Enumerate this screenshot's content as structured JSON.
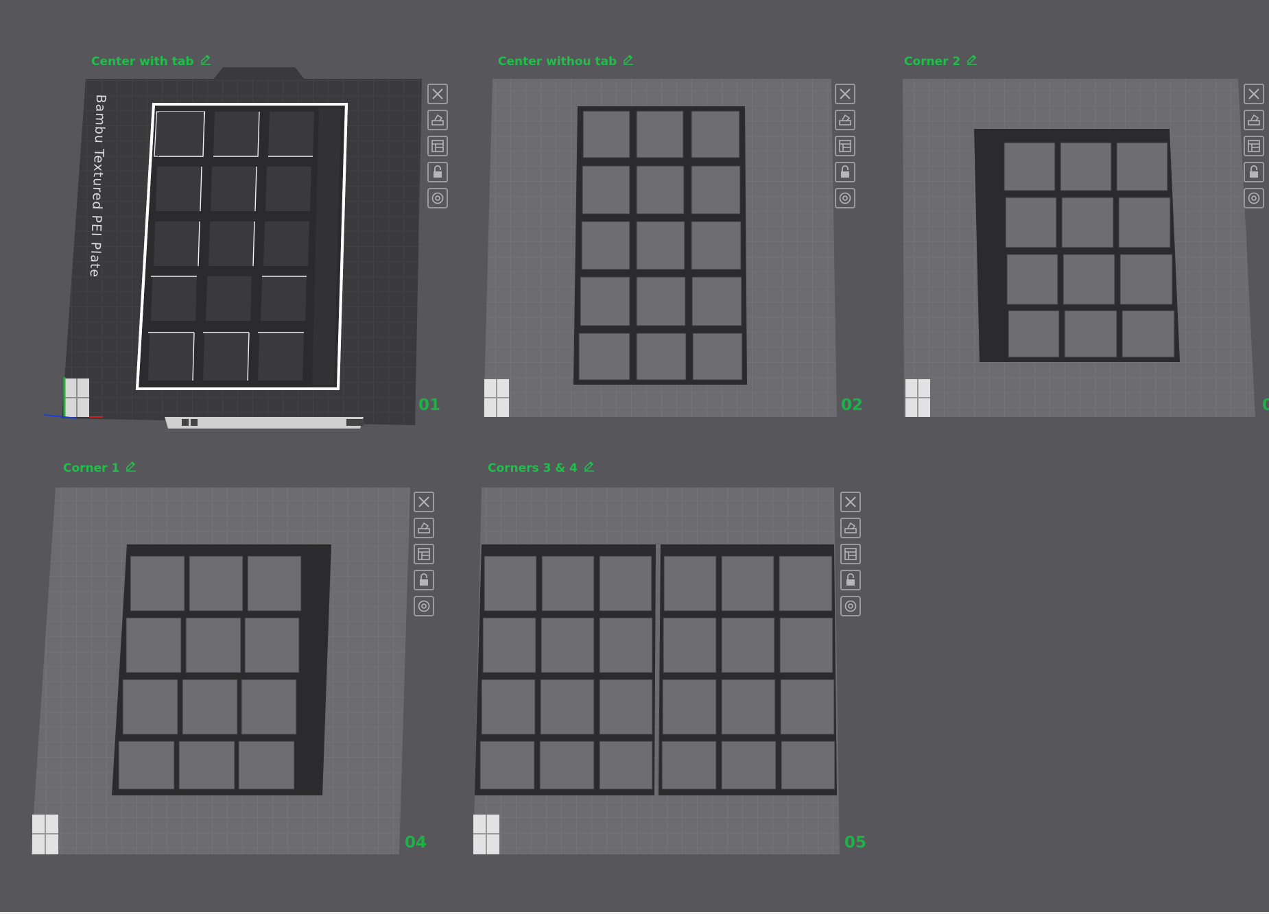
{
  "plates": [
    {
      "number": "01",
      "title": "Center with tab",
      "bed_label": "Bambu Textured PEI Plate",
      "active": true
    },
    {
      "number": "02",
      "title": "Center withou tab",
      "active": false
    },
    {
      "number": "0",
      "title": "Corner 2",
      "active": false
    },
    {
      "number": "04",
      "title": "Corner 1",
      "active": false
    },
    {
      "number": "05",
      "title": "Corners 3 & 4",
      "active": false
    }
  ],
  "toolbar_buttons": [
    "close-plate",
    "auto-orient",
    "arrange",
    "lock-plate",
    "plate-settings"
  ],
  "icons": {
    "edit": "pencil-icon",
    "close": "close-icon",
    "orient": "auto-orient-icon",
    "arrange": "arrange-icon",
    "lock": "lock-icon",
    "settings": "gear-icon"
  },
  "colors": {
    "background": "#56565b",
    "title_green": "#1fbf4a",
    "number_green": "#1db247",
    "bed_light": "#6b6b70",
    "bed_dark": "#3a3a3d",
    "part": "#2b2b2d",
    "selection": "#ffffff"
  }
}
